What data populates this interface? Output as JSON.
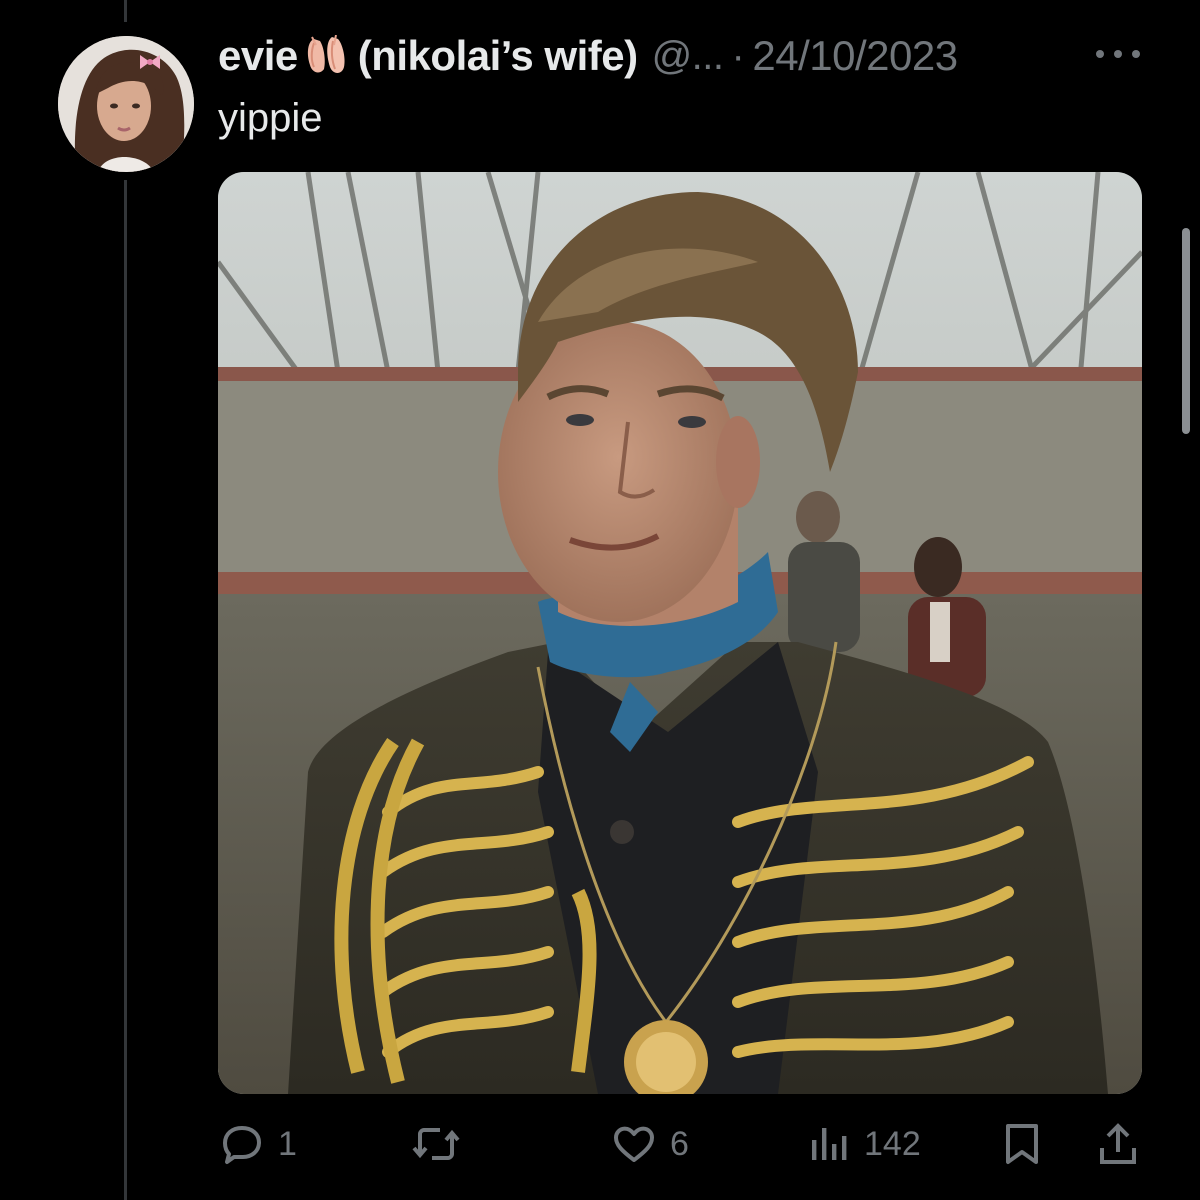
{
  "tweet": {
    "author_name": "evie",
    "author_name_suffix": "(nikolai’s wife)",
    "author_handle": "@...",
    "separator": "·",
    "date": "24/10/2023",
    "text": "yippie",
    "icons": {
      "avatar": "profile-photo",
      "name_emoji": "ballet-shoes-icon",
      "more": "more-options-icon",
      "media": "photo-young-man-military-jacket-gold-braid"
    }
  },
  "actions": {
    "replies": "1",
    "reposts": "",
    "likes": "6",
    "views": "142",
    "icons": [
      "reply-icon",
      "repost-icon",
      "like-icon",
      "views-icon",
      "bookmark-icon",
      "share-icon"
    ]
  },
  "colors": {
    "background": "#000000",
    "text_primary": "#e7e9ea",
    "text_secondary": "#71767b",
    "thread_line": "#333639"
  }
}
